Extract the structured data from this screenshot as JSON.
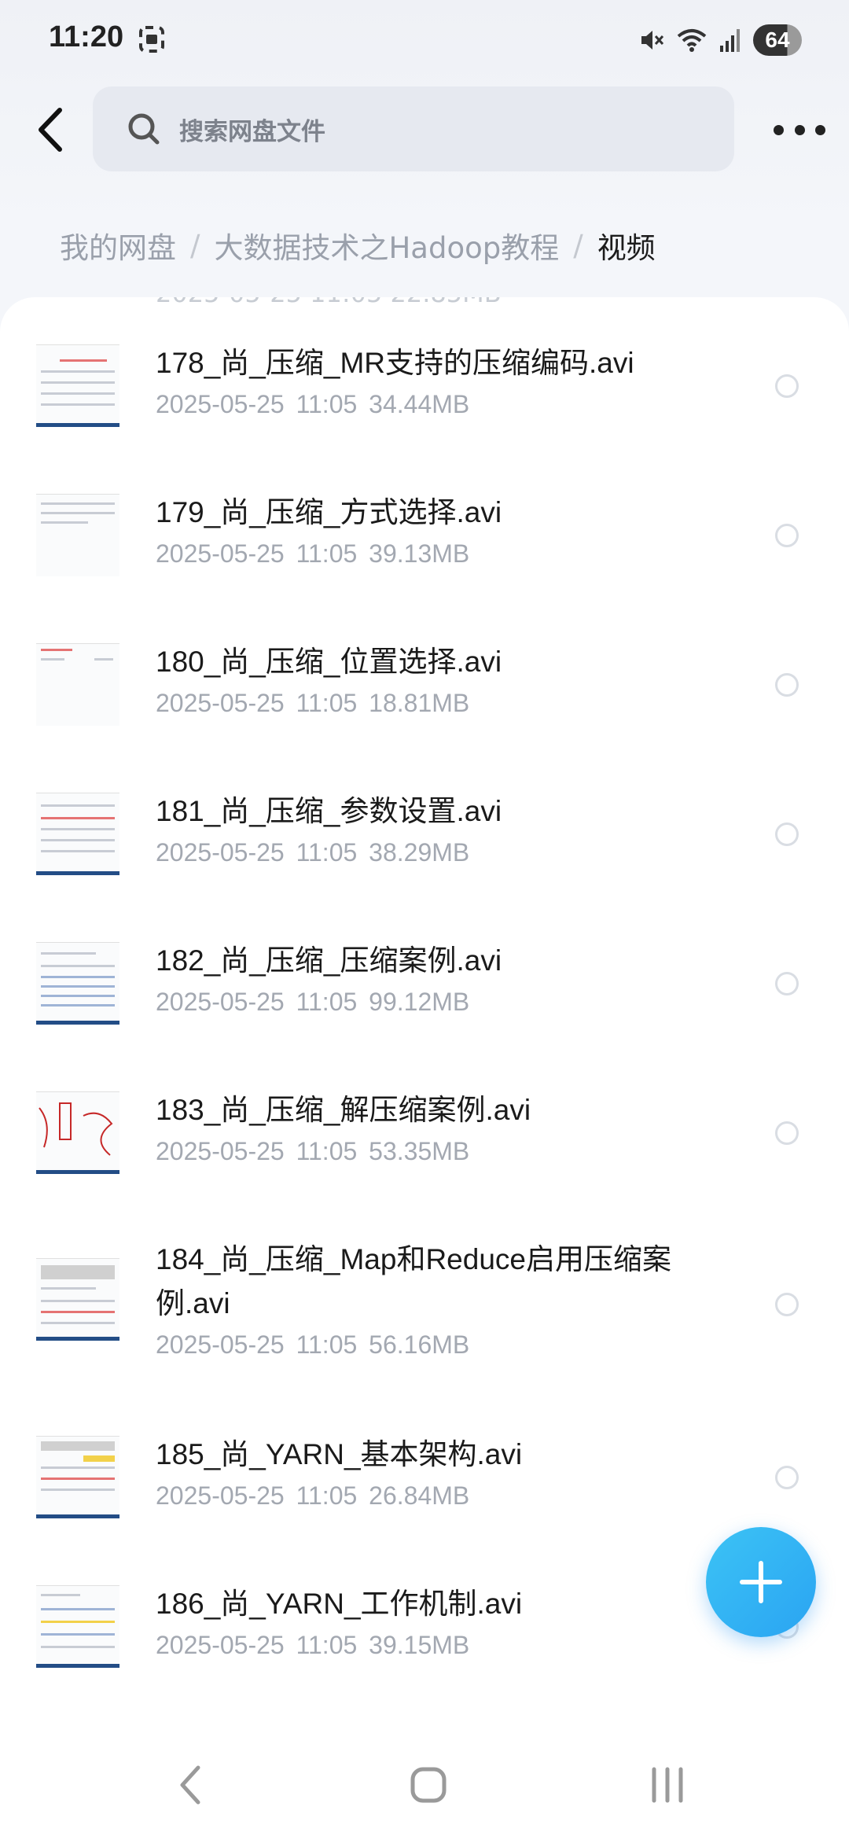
{
  "status_bar": {
    "time": "11:20",
    "battery": "64",
    "icons": [
      "screenshot-icon",
      "mute-icon",
      "wifi-icon",
      "signal-icon",
      "battery-icon"
    ]
  },
  "header": {
    "search_placeholder": "搜索网盘文件"
  },
  "breadcrumb": {
    "items": [
      "我的网盘",
      "大数据技术之Hadoop教程",
      "视频"
    ]
  },
  "files": [
    {
      "name": "178_尚_压缩_MR支持的压缩编码.avi",
      "date": "2025-05-25",
      "time": "11:05",
      "size": "34.44MB"
    },
    {
      "name": "179_尚_压缩_方式选择.avi",
      "date": "2025-05-25",
      "time": "11:05",
      "size": "39.13MB"
    },
    {
      "name": "180_尚_压缩_位置选择.avi",
      "date": "2025-05-25",
      "time": "11:05",
      "size": "18.81MB"
    },
    {
      "name": "181_尚_压缩_参数设置.avi",
      "date": "2025-05-25",
      "time": "11:05",
      "size": "38.29MB"
    },
    {
      "name": "182_尚_压缩_压缩案例.avi",
      "date": "2025-05-25",
      "time": "11:05",
      "size": "99.12MB"
    },
    {
      "name": "183_尚_压缩_解压缩案例.avi",
      "date": "2025-05-25",
      "time": "11:05",
      "size": "53.35MB"
    },
    {
      "name": "184_尚_压缩_Map和Reduce启用压缩案例.avi",
      "date": "2025-05-25",
      "time": "11:05",
      "size": "56.16MB"
    },
    {
      "name": "185_尚_YARN_基本架构.avi",
      "date": "2025-05-25",
      "time": "11:05",
      "size": "26.84MB"
    },
    {
      "name": "186_尚_YARN_工作机制.avi",
      "date": "2025-05-25",
      "time": "11:05",
      "size": "39.15MB"
    }
  ],
  "colors": {
    "accent": "#2aa4f2",
    "text_primary": "#1a1a1a",
    "text_secondary": "#a3a8b1"
  }
}
